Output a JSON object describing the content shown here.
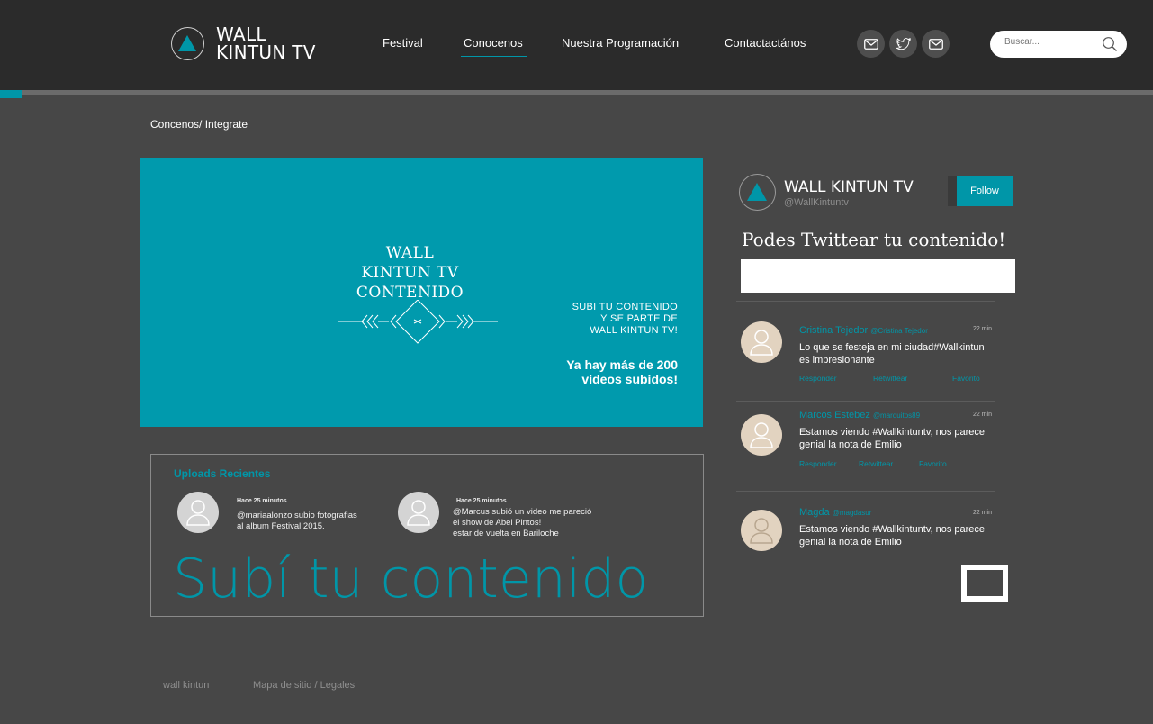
{
  "header": {
    "logo": {
      "line1": "WALL",
      "line2": "KINTUN TV"
    },
    "nav": [
      {
        "label": "Festival",
        "active": false
      },
      {
        "label": "Conocenos",
        "active": true
      },
      {
        "label": "Nuestra Programación",
        "active": false
      },
      {
        "label": "Contactactános",
        "active": false
      }
    ],
    "social_icons": [
      "mail-icon",
      "twitter-icon",
      "mail-icon"
    ],
    "search": {
      "placeholder": "Buscar..."
    }
  },
  "breadcrumb": "Concenos/ Integrate",
  "banner": {
    "title": [
      "WALL",
      "KINTUN TV",
      "CONTENIDO"
    ],
    "subtitle": [
      "SUBI TU CONTENIDO",
      "Y SE PARTE DE",
      "WALL KINTUN TV!"
    ],
    "count": [
      "Ya hay más de 200",
      "videos subidos!"
    ]
  },
  "uploads": {
    "title": "Uploads Recientes",
    "items": [
      {
        "time": "Hace 25 minutos",
        "lines": [
          "@mariaalonzo subio fotografias",
          "al album Festival 2015."
        ]
      },
      {
        "time": "Hace 25 minutos",
        "lines": [
          "@Marcus subió un video me pareció",
          "el show de Abel Pintos!",
          "estar de vuelta en Bariloche"
        ]
      }
    ],
    "cta": "Subí tu contenido"
  },
  "twitter": {
    "name": "WALL KINTUN TV",
    "handle": "@WallKintuntv",
    "follow_label": "Follow",
    "heading": "Podes Twittear tu contenido!",
    "tweets": [
      {
        "name": "Cristina Tejedor",
        "handle": "@Cristina Tejedor",
        "time": "22 min",
        "text": [
          "Lo que se festeja en mi ciudad#Wallkintun",
          "es impresionante"
        ],
        "actions": [
          "Responder",
          "Retwittear",
          "Favorito"
        ]
      },
      {
        "name": "Marcos Estebez",
        "handle": "@marquitos89",
        "time": "22 min",
        "text": [
          "Estamos viendo #Wallkintuntv, nos parece",
          "genial la nota de Emilio"
        ],
        "actions": [
          "Responder",
          "Retwittear",
          "Favorito"
        ]
      },
      {
        "name": "Magda",
        "handle": "@magdasur",
        "time": "22 min",
        "text": [
          "Estamos viendo #Wallkintuntv, nos parece",
          "genial la nota de Emilio"
        ],
        "actions": []
      }
    ]
  },
  "footer": {
    "links": [
      "wall kintun",
      "Mapa de sitio / Legales"
    ]
  },
  "colors": {
    "accent": "#0096a8",
    "background": "#474747",
    "header": "#2b2b2b"
  }
}
